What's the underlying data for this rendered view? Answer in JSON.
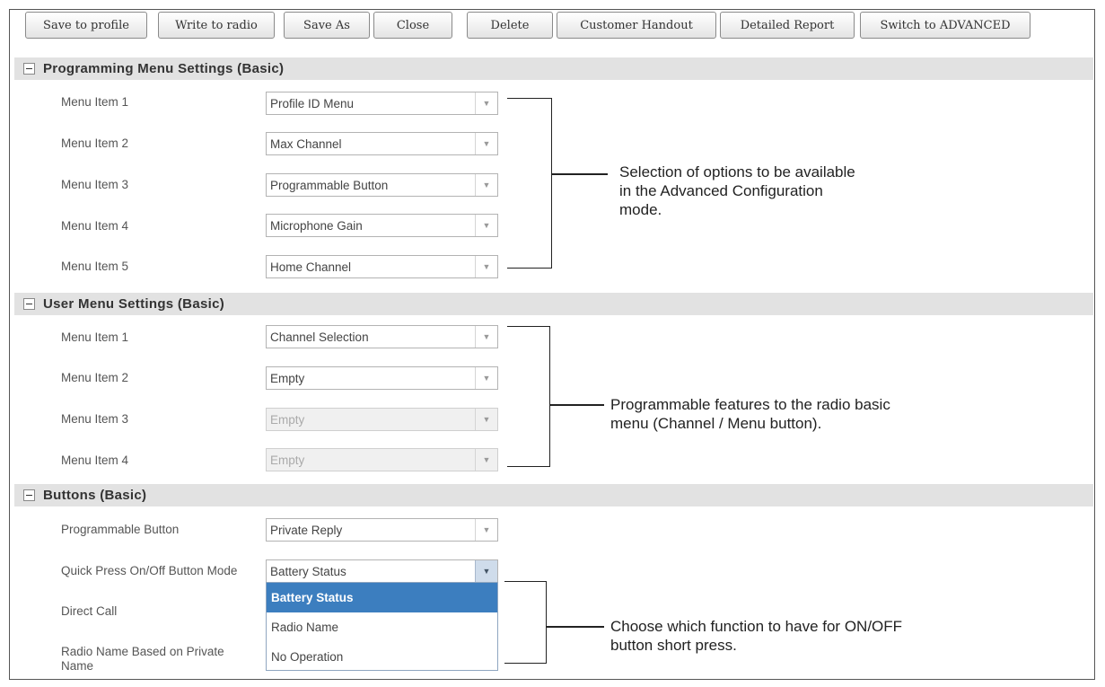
{
  "toolbar": {
    "save_profile": "Save to profile",
    "write_radio": "Write to radio",
    "save_as": "Save As",
    "close": "Close",
    "delete": "Delete",
    "handout": "Customer Handout",
    "report": "Detailed Report",
    "switch": "Switch to ADVANCED"
  },
  "programming": {
    "title": "Programming Menu Settings (Basic)",
    "items": [
      {
        "label": "Menu Item 1",
        "value": "Profile ID Menu"
      },
      {
        "label": "Menu Item 2",
        "value": "Max Channel"
      },
      {
        "label": "Menu Item 3",
        "value": "Programmable Button"
      },
      {
        "label": "Menu Item 4",
        "value": "Microphone Gain"
      },
      {
        "label": "Menu Item 5",
        "value": "Home Channel"
      }
    ],
    "note": [
      "Selection of options to be available",
      "in the Advanced Configuration",
      "mode."
    ]
  },
  "user_menu": {
    "title": "User Menu Settings (Basic)",
    "items": [
      {
        "label": "Menu Item 1",
        "value": "Channel Selection"
      },
      {
        "label": "Menu Item 2",
        "value": "Empty"
      },
      {
        "label": "Menu Item 3",
        "value": "Empty"
      },
      {
        "label": "Menu Item 4",
        "value": "Empty"
      }
    ],
    "note": [
      "Programmable features to the radio basic",
      "menu (Channel / Menu button)."
    ]
  },
  "buttons": {
    "title": "Buttons (Basic)",
    "programmable_label": "Programmable Button",
    "programmable_value": "Private Reply",
    "quick_press_label": "Quick Press On/Off Button Mode",
    "quick_press_value": "Battery Status",
    "direct_call_label": "Direct Call",
    "radio_name_label_1": "Radio Name Based on Private",
    "radio_name_label_2": "Name",
    "options": [
      "Battery Status",
      "Radio Name",
      "No Operation"
    ],
    "note": [
      "Choose which function to have for ON/OFF",
      "button short press."
    ]
  }
}
